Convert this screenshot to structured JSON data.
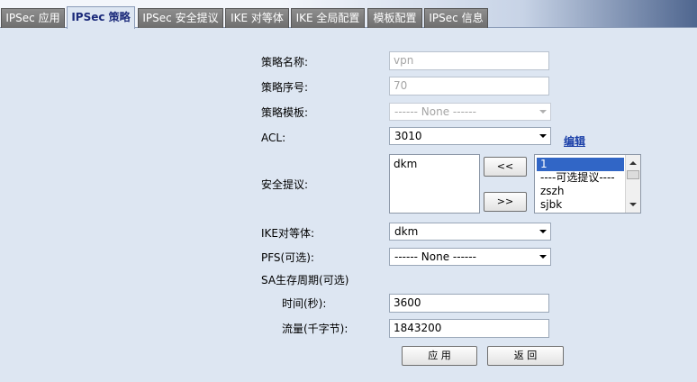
{
  "tabs": [
    {
      "label": "IPSec 应用"
    },
    {
      "label": "IPSec 策略",
      "active": true
    },
    {
      "label": "IPSec 安全提议"
    },
    {
      "label": "IKE 对等体"
    },
    {
      "label": "IKE 全局配置"
    },
    {
      "label": "模板配置"
    },
    {
      "label": "IPSec 信息"
    }
  ],
  "form": {
    "policy_name": {
      "label": "策略名称:",
      "value": "vpn"
    },
    "policy_seq": {
      "label": "策略序号:",
      "value": "70"
    },
    "policy_template": {
      "label": "策略模板:",
      "value": "------ None ------"
    },
    "acl": {
      "label": "ACL:",
      "value": "3010",
      "edit_link": "编辑"
    },
    "proposal": {
      "label": "安全提议:",
      "selected_items": [
        "dkm"
      ],
      "add_label": "<<",
      "remove_label": ">>",
      "available_items": [
        "1",
        "----可选提议----",
        "zszh",
        "sjbk"
      ]
    },
    "ike_peer": {
      "label": "IKE对等体:",
      "value": "dkm"
    },
    "pfs": {
      "label": "PFS(可选):",
      "value": "------ None ------"
    },
    "sa_lifetime": {
      "label": "SA生存周期(可选)"
    },
    "time": {
      "label": "时间(秒):",
      "value": "3600"
    },
    "traffic": {
      "label": "流量(千字节):",
      "value": "1843200"
    }
  },
  "buttons": {
    "apply": "应 用",
    "back": "返 回"
  }
}
